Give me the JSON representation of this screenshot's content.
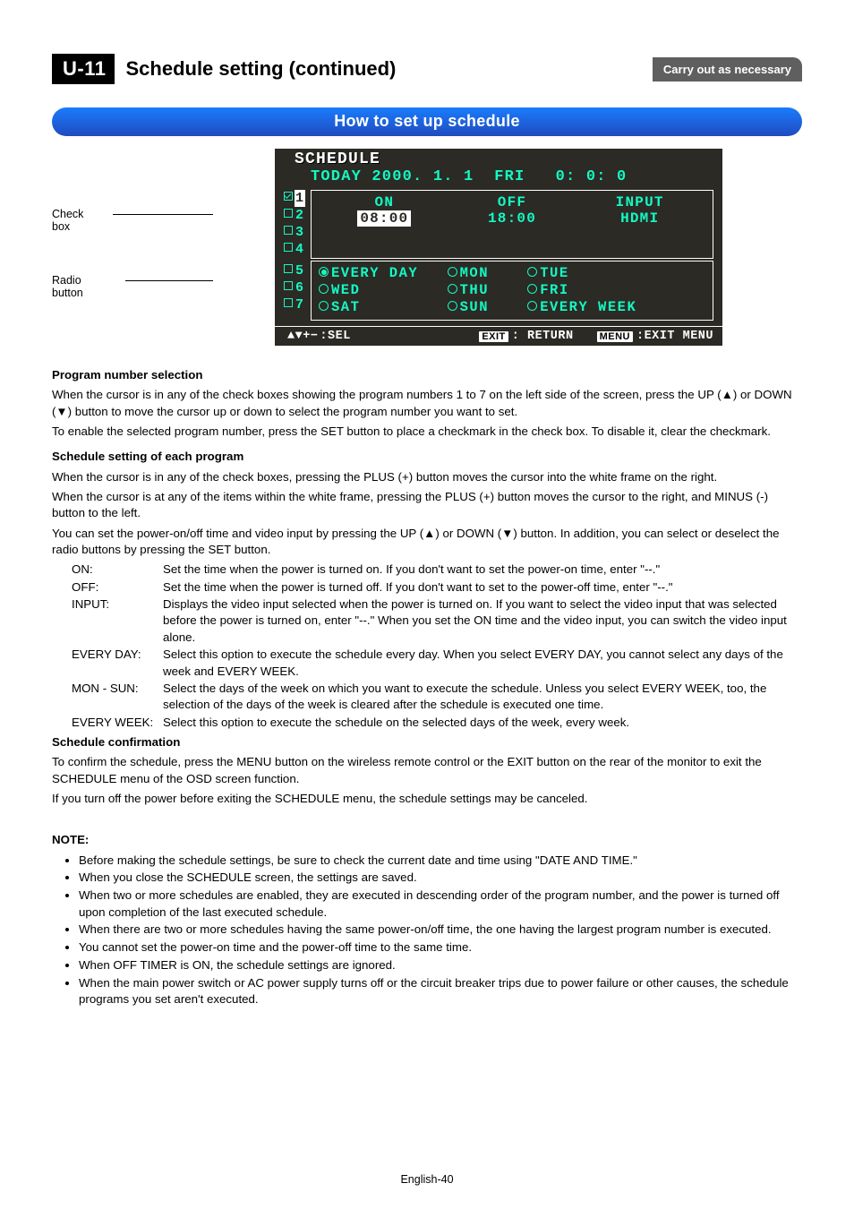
{
  "header": {
    "code": "U-11",
    "title": "Schedule setting (continued)",
    "badge": "Carry out as necessary"
  },
  "blue_bar": "How to set up schedule",
  "callouts": {
    "checkbox": "Check box",
    "radiobutton": "Radio button"
  },
  "osd": {
    "title": "SCHEDULE",
    "today_line": "TODAY 2000. 1. 1  FRI   0: 0: 0",
    "numbers": [
      "1",
      "2",
      "3",
      "4",
      "5",
      "6",
      "7"
    ],
    "col_headers": {
      "on": "ON",
      "off": "OFF",
      "input": "INPUT"
    },
    "values": {
      "on": "08:00",
      "off": "18:00",
      "input": "HDMI"
    },
    "days_rows": [
      {
        "cells": [
          "EVERY DAY",
          "MON",
          "TUE"
        ],
        "selected": [
          true,
          false,
          false
        ]
      },
      {
        "cells": [
          "WED",
          "THU",
          "FRI"
        ],
        "selected": [
          false,
          false,
          false
        ]
      },
      {
        "cells": [
          "SAT",
          "SUN",
          "EVERY WEEK"
        ],
        "selected": [
          false,
          false,
          false
        ]
      }
    ],
    "footer": {
      "sel_glyph": "▲▼+−",
      "sel": ":SEL",
      "exit_key": "EXIT",
      "exit": ": RETURN",
      "menu_key": "MENU",
      "menu": ":EXIT MENU"
    }
  },
  "body": {
    "h_pns": "Program number selection",
    "p_pns1": "When the cursor is in any of the check boxes showing the program numbers 1 to 7 on the left side of the screen, press the UP (▲) or DOWN (▼) button to move the cursor up or down to select the program number you want to set.",
    "p_pns2": "To enable the selected program number, press the SET button to place a checkmark in the check box. To disable it, clear the checkmark.",
    "h_ss": "Schedule setting of each program",
    "p_ss1": "When the cursor is in any of the check boxes, pressing the PLUS (+) button moves the cursor into the white frame on the right.",
    "p_ss2": "When the cursor is at any of the items within the white frame, pressing the PLUS (+) button moves the cursor to the right, and MINUS (-) button to the left.",
    "p_ss3": "You can set the power-on/off time and video input by pressing the UP (▲) or DOWN (▼) button. In addition, you can select or deselect the radio buttons by pressing the SET button.",
    "defs": [
      {
        "term": "ON:",
        "desc": "Set the time when the power is turned on. If you don't want to set the power-on time, enter \"--.\""
      },
      {
        "term": "OFF:",
        "desc": "Set the time when the power is turned off. If you don't want to set to the power-off time, enter \"--.\""
      },
      {
        "term": "INPUT:",
        "desc": "Displays the video input selected when the power is turned on. If you want to select the video input that was selected before the power is turned on, enter \"--.\" When you set the ON time and the video input, you can switch the video input alone."
      },
      {
        "term": "EVERY DAY:",
        "desc": "Select this option to execute the schedule every day. When you select EVERY DAY, you cannot select any days of the week and EVERY WEEK."
      },
      {
        "term": "MON - SUN:",
        "desc": "Select the days of the week on which you want to execute the schedule. Unless you select EVERY WEEK, too, the selection of the days of the week is cleared after the schedule is executed one time."
      },
      {
        "term": "EVERY WEEK:",
        "desc": "Select this option to execute the schedule on the selected days of the week, every week."
      }
    ],
    "h_sc": "Schedule confirmation",
    "p_sc1": "To confirm the schedule, press the MENU button on the wireless remote control or the EXIT button on the rear of the monitor to exit the SCHEDULE menu of the OSD screen function.",
    "p_sc2": "If you turn off the power before exiting the SCHEDULE menu, the schedule settings may be canceled.",
    "note_label": "NOTE:",
    "notes": [
      "Before making the schedule settings, be sure to check the current date and time using \"DATE AND TIME.\"",
      "When you close the SCHEDULE screen, the settings are saved.",
      "When two or more schedules are enabled, they are executed in descending order of the program number, and the power is turned off upon completion of the last executed schedule.",
      "When there are two or more schedules having the same power-on/off time, the one having the largest program number is executed.",
      "You cannot set the power-on time and the power-off time to the same time.",
      "When OFF TIMER is ON, the schedule settings are ignored.",
      "When the main power switch or AC power supply turns off or the circuit breaker trips due to power failure or other causes, the schedule programs you set aren't executed."
    ]
  },
  "page_number": "English-40"
}
